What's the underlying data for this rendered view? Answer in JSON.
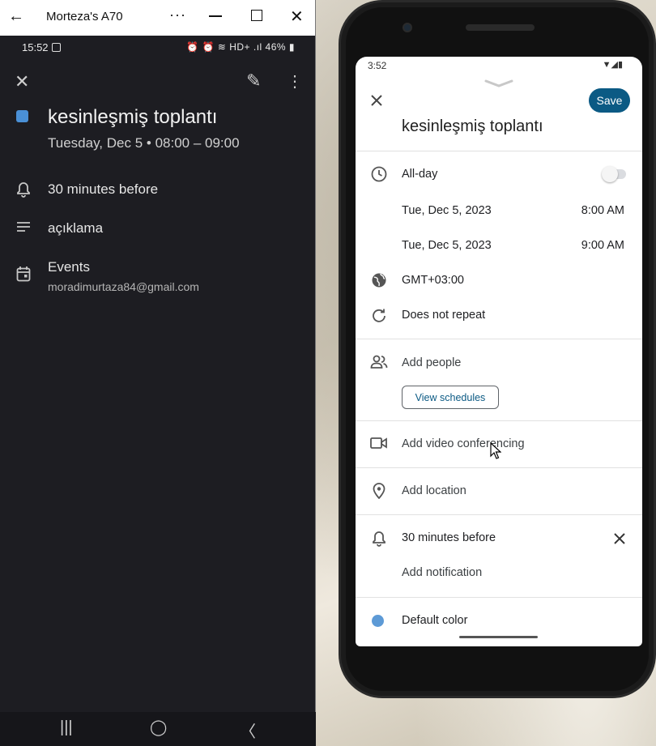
{
  "window": {
    "title": "Morteza's A70",
    "back_glyph": "←",
    "more_glyph": "···",
    "close_glyph": "✕"
  },
  "left_phone": {
    "status": {
      "time": "15:52",
      "right": "⏰ ⏰ ≋ HD+ .ıl 46% ▮"
    },
    "event": {
      "title": "kesinleşmiş toplantı",
      "when": "Tuesday, Dec 5  •  08:00 – 09:00",
      "notification": "30 minutes before",
      "description": "açıklama",
      "calendar_name": "Events",
      "calendar_account": "moradimurtaza84@gmail.com",
      "color": "#4a90d6"
    },
    "icons": {
      "close": "✕",
      "edit": "✎",
      "more": "⋮",
      "bell": "🔔︎",
      "notes": "≡",
      "calendar": "▣"
    },
    "navbar": {
      "recents": "|||",
      "home": "◯",
      "back": "〈"
    }
  },
  "right_phone": {
    "status": {
      "time": "3:52",
      "icons": "▼◢▮"
    },
    "title": "kesinleşmiş toplantı",
    "save_label": "Save",
    "all_day_label": "All-day",
    "start_date": "Tue, Dec 5, 2023",
    "start_time": "8:00 AM",
    "end_date": "Tue, Dec 5, 2023",
    "end_time": "9:00 AM",
    "timezone": "GMT+03:00",
    "repeat": "Does not repeat",
    "add_people": "Add people",
    "view_schedules": "View schedules",
    "add_video": "Add video conferencing",
    "add_location": "Add location",
    "notification": "30 minutes before",
    "add_notification": "Add notification",
    "color_label": "Default color",
    "accent": "#0b5a84",
    "default_color": "#5d9ad6"
  }
}
